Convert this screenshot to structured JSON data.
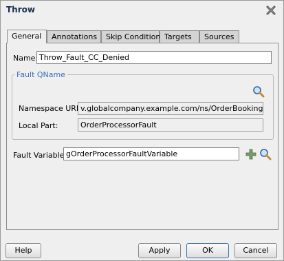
{
  "dialog": {
    "title": "Throw"
  },
  "tabs": [
    {
      "label": "General",
      "active": true
    },
    {
      "label": "Annotations"
    },
    {
      "label": "Skip Condition"
    },
    {
      "label": "Targets"
    },
    {
      "label": "Sources"
    }
  ],
  "form": {
    "name_label": "Name:",
    "name_value": "Throw_Fault_CC_Denied",
    "fault_qname_legend": "Fault QName",
    "namespace_label": "Namespace URI:",
    "namespace_value": "v.globalcompany.example.com/ns/OrderBookingService",
    "local_part_label": "Local Part:",
    "local_part_value": "OrderProcessorFault",
    "fault_variable_label": "Fault Variable:",
    "fault_variable_value": "gOrderProcessorFaultVariable"
  },
  "buttons": {
    "help": "Help",
    "apply": "Apply",
    "ok": "OK",
    "cancel": "Cancel"
  },
  "icons": {
    "close": "close-icon",
    "search": "search-icon",
    "add": "plus-icon"
  },
  "colors": {
    "title": "#1c2f4f",
    "legend": "#3b6db6",
    "default_button_border": "#3b6db6"
  }
}
